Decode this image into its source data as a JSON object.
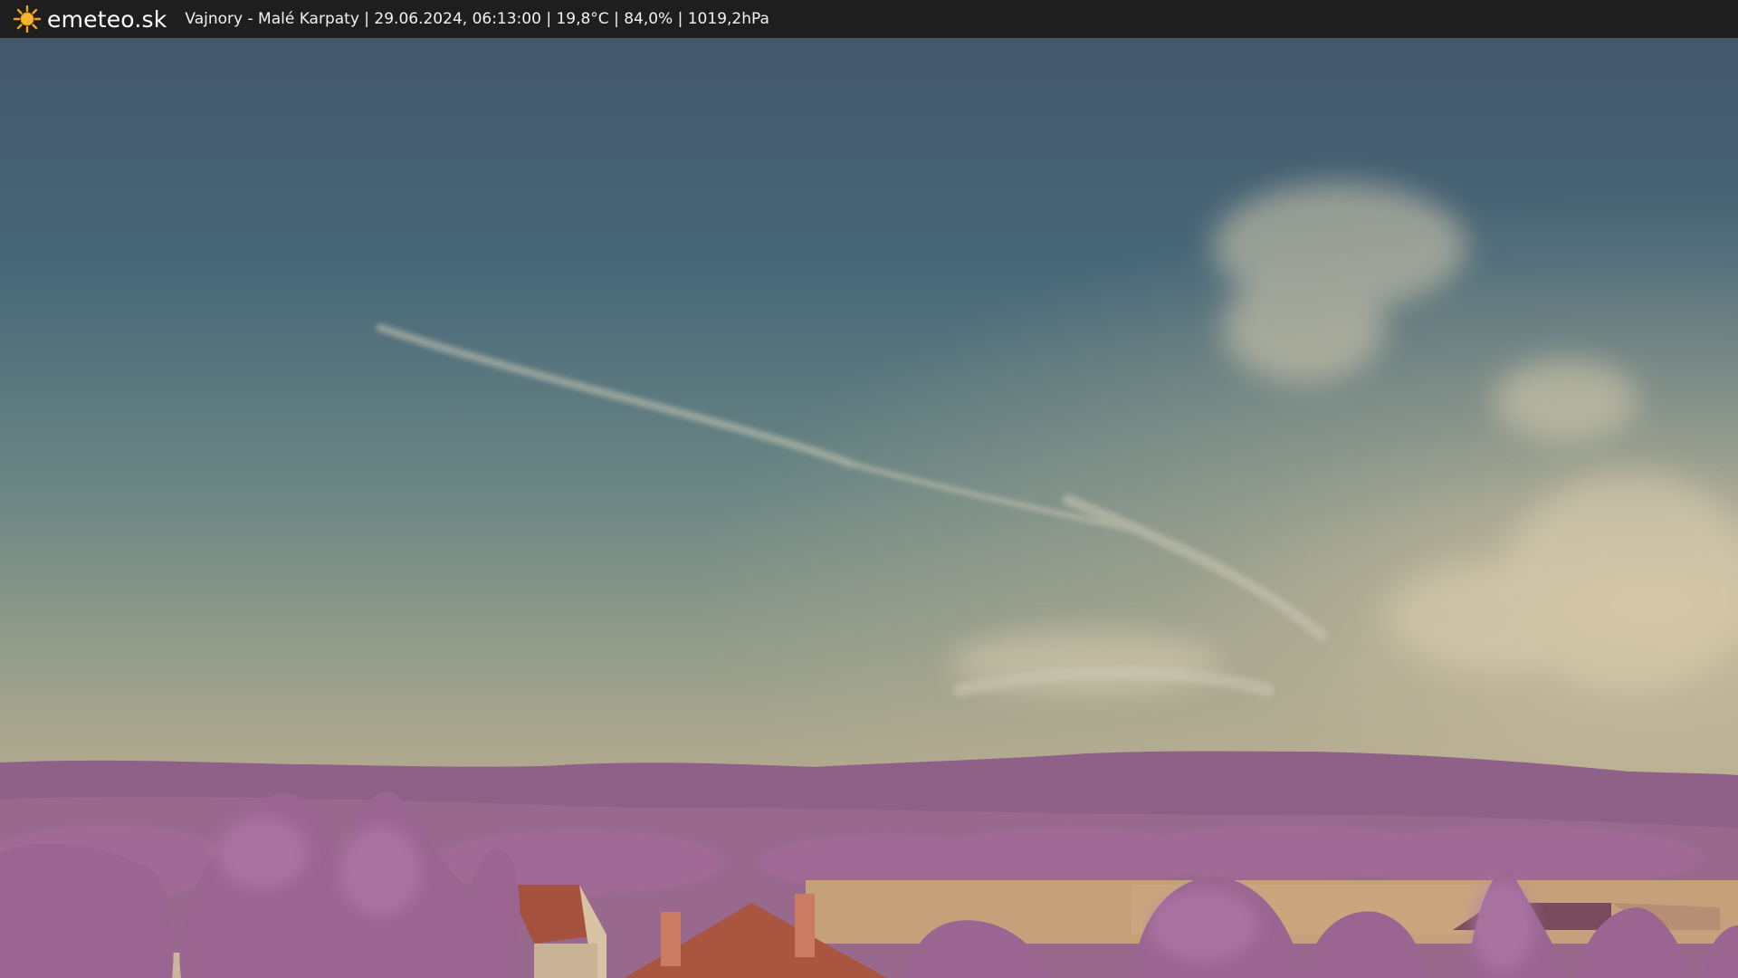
{
  "header": {
    "site_name": "emeteo.sk",
    "logo_icon": "sun-icon",
    "info": "Vajnory - Malé Karpaty | 29.06.2024, 06:13:00 | 19,8°C | 84,0% | 1019,2hPa"
  },
  "colors": {
    "bar_background": "#1e1e1e",
    "sun": "#f2a51c",
    "sky_top": "#3f5466",
    "sky_horizon": "#b2ab8e",
    "hills": "#8d5f86",
    "trees": "#9c6594",
    "roofs": "#a8523f",
    "field": "#c2a17a"
  }
}
